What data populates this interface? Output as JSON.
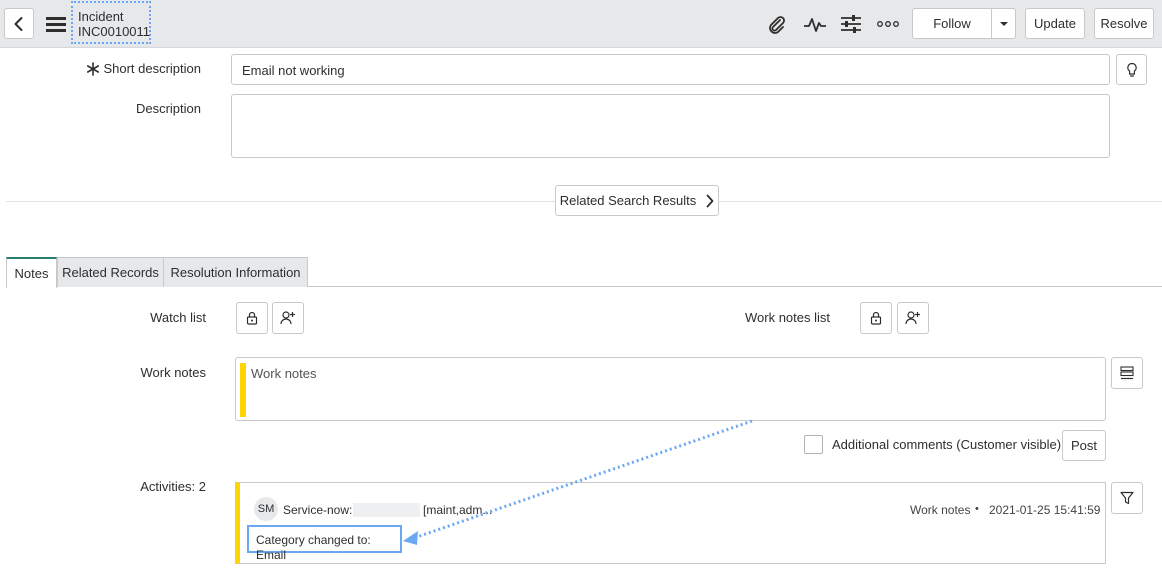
{
  "header": {
    "record_type": "Incident",
    "record_number": "INC0010011"
  },
  "toolbar": {
    "follow_label": "Follow",
    "update_label": "Update",
    "resolve_label": "Resolve"
  },
  "form": {
    "short_description_label": "Short description",
    "short_description_value": "Email not working",
    "description_label": "Description",
    "description_value": "",
    "related_search_label": "Related Search Results"
  },
  "tabs": [
    {
      "label": "Notes"
    },
    {
      "label": "Related Records"
    },
    {
      "label": "Resolution Information"
    }
  ],
  "notes": {
    "watch_list_label": "Watch list",
    "work_notes_list_label": "Work notes list",
    "work_notes_label": "Work notes",
    "work_notes_placeholder": "Work notes",
    "additional_comments_label": "Additional comments (Customer visible)",
    "post_label": "Post",
    "activities_label": "Activities: 2"
  },
  "activity": {
    "avatar_initials": "SM",
    "author": "Service-now:",
    "roles": "[maint,adm...",
    "type": "Work notes",
    "separator": "•",
    "timestamp": "2021-01-25 15:41:59",
    "message": "Category changed to: Email"
  },
  "colors": {
    "accent": "#ffd500",
    "highlight": "#6aa9f2",
    "topbar": "#e6e8ea"
  }
}
